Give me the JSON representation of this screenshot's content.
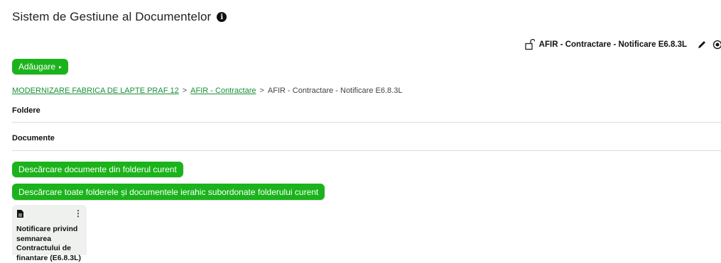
{
  "header": {
    "title": "Sistem de Gestiune al Documentelor",
    "info_icon": "info-icon"
  },
  "folder_header": {
    "name": "AFIR - Contractare - Notificare E6.8.3L",
    "icons": [
      "lock-open-icon",
      "pencil-icon",
      "eye-icon"
    ]
  },
  "toolbar": {
    "add_label": "Adăugare",
    "add_caret": "▸"
  },
  "breadcrumb": {
    "items": [
      {
        "label": "MODERNIZARE FABRICA DE LAPTE PRAF 12",
        "link": true
      },
      {
        "label": "AFIR - Contractare",
        "link": true
      },
      {
        "label": "AFIR - Contractare - Notificare E6.8.3L",
        "link": false
      }
    ],
    "separator": ">"
  },
  "sections": {
    "folders": "Foldere",
    "documents": "Documente"
  },
  "actions": {
    "download_current": "Descărcare documente din folderul curent",
    "download_all": "Descărcare toate folderele și documentele ierahic subordonate folderului curent"
  },
  "documents": [
    {
      "title": "Notificare privind semnarea Contractului de finantare (E6.8.3L)",
      "icon": "document-icon"
    }
  ],
  "colors": {
    "accent": "#1bb31b",
    "link": "#1a8f3a"
  }
}
